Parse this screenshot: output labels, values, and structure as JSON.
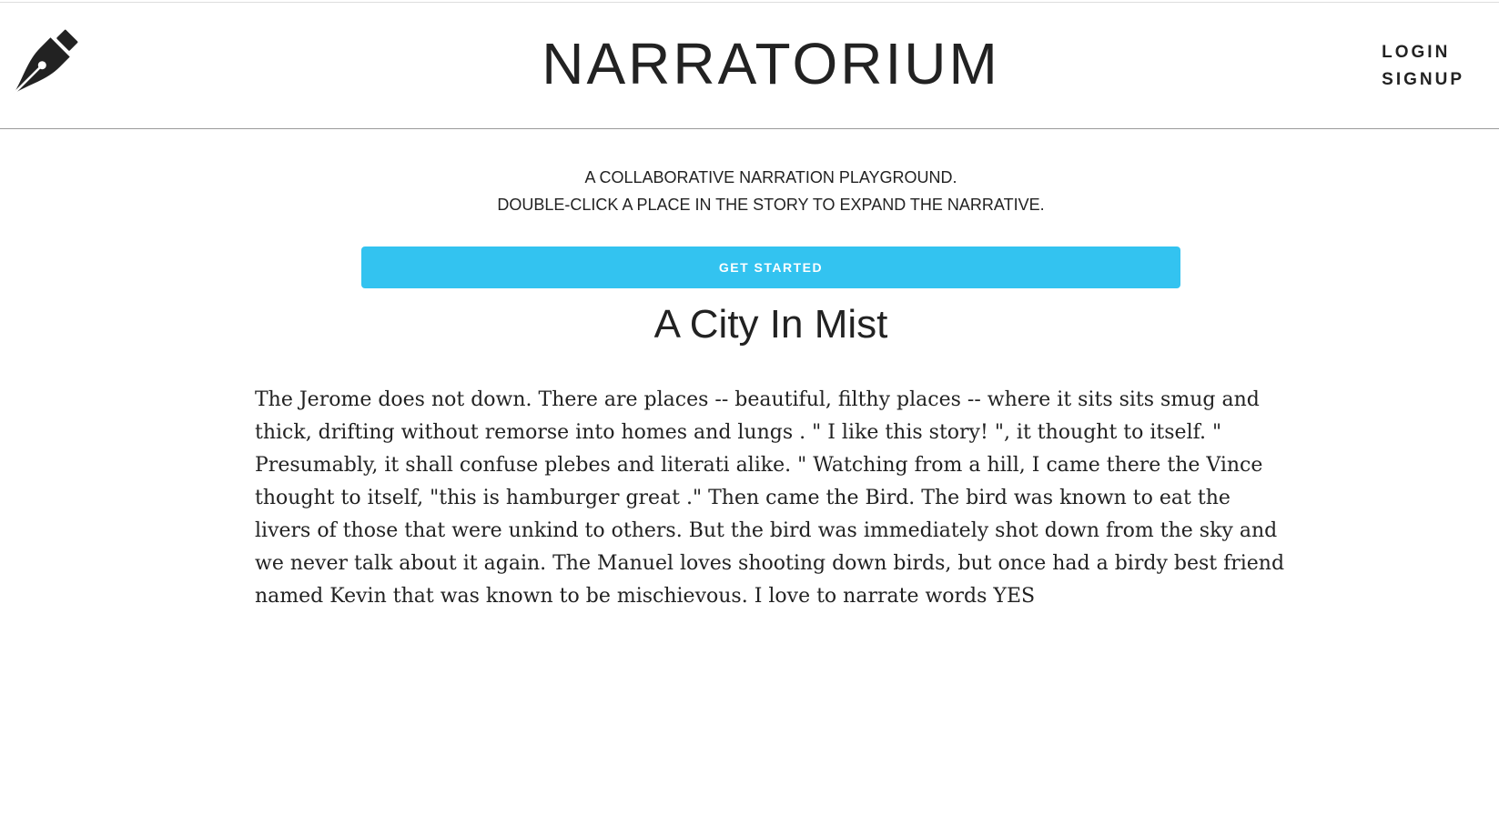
{
  "header": {
    "logo_icon": "fountain-pen-nib-icon",
    "title": "NARRATORIUM",
    "login_label": "LOGIN",
    "signup_label": "SIGNUP"
  },
  "intro": {
    "line1": "A COLLABORATIVE NARRATION PLAYGROUND.",
    "line2": "DOUBLE-CLICK A PLACE IN THE STORY TO EXPAND THE NARRATIVE."
  },
  "cta": {
    "label": "GET STARTED",
    "color": "#33c3f0"
  },
  "story": {
    "title": "A City In Mist",
    "body": "The Jerome does not down. There are places -- beautiful, filthy places -- where it sits sits smug and thick, drifting without remorse into homes and lungs . \" I like this story! \", it thought to itself. \" Presumably, it shall confuse plebes and literati alike. \" Watching from a hill, I came there the Vince thought to itself, \"this is hamburger great .\" Then came the Bird. The bird was known to eat the livers of those that were unkind to others. But the bird was immediately shot down from the sky and we never talk about it again. The Manuel loves shooting down birds, but once had a birdy best friend named Kevin that was known to be mischievous. I love to narrate words YES"
  }
}
